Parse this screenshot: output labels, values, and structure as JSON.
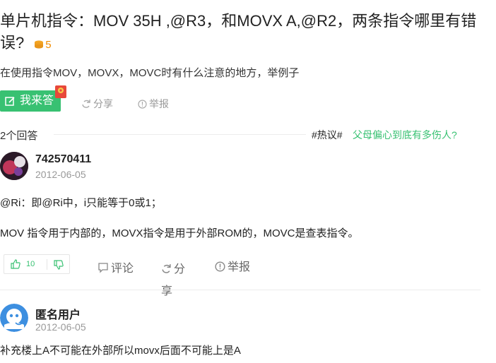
{
  "question": {
    "title": "单片机指令：MOV 35H ,@R3，和MOVX A,@R2，两条指令哪里有错误?",
    "reward": "5",
    "description": "在使用指令MOV，MOVX，MOVC时有什么注意的地方，举例子",
    "answer_button": "我来答",
    "share": "分享",
    "report": "举报"
  },
  "answers_header": {
    "count": "2个回答",
    "hot_tag": "#热议#",
    "hot_topic": "父母偏心到底有多伤人?"
  },
  "answers": [
    {
      "username": "742570411",
      "date": "2012-06-05",
      "paragraphs": [
        "@Ri：即@Ri中，i只能等于0或1；",
        "MOV 指令用于内部的，MOVX指令是用于外部ROM的，MOVC是查表指令。"
      ],
      "likes": "10",
      "comment": "评论",
      "share_line1": "分",
      "share_line2": "享",
      "report": "举报"
    },
    {
      "username": "匿名用户",
      "date": "2012-06-05",
      "paragraphs": [
        "补充楼上A不可能在外部所以movx后面不可能上是A"
      ]
    }
  ],
  "colors": {
    "accent_green": "#38c172",
    "reward_orange": "#f08c00",
    "muted": "#999999"
  },
  "icons": [
    "edit-icon",
    "coin-icon",
    "red-envelope-icon",
    "share-icon",
    "report-icon",
    "thumb-up-icon",
    "thumb-down-icon",
    "comment-icon",
    "avatar-anonymous-icon"
  ]
}
